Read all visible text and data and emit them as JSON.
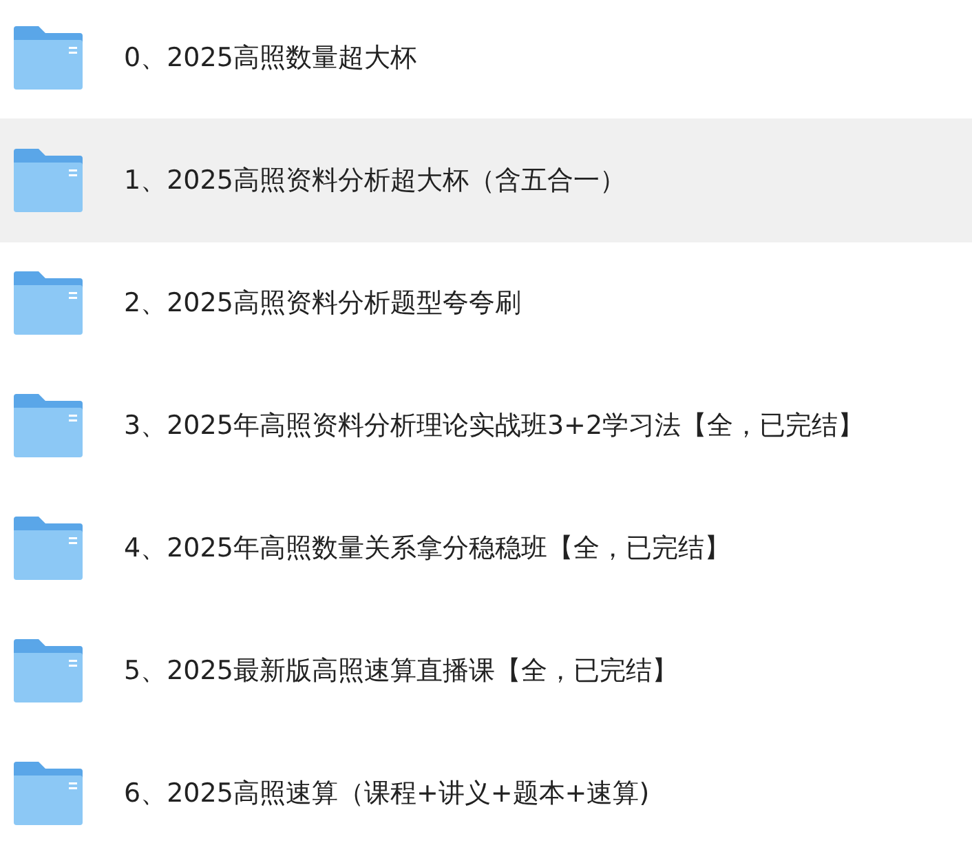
{
  "folders": [
    {
      "name": "0、2025高照数量超大杯",
      "selected": false
    },
    {
      "name": "1、2025高照资料分析超大杯（含五合一）",
      "selected": true
    },
    {
      "name": "2、2025高照资料分析题型夸夸刷",
      "selected": false
    },
    {
      "name": "3、2025年高照资料分析理论实战班3+2学习法【全，已完结】",
      "selected": false
    },
    {
      "name": "4、2025年高照数量关系拿分稳稳班【全，已完结】",
      "selected": false
    },
    {
      "name": "5、2025最新版高照速算直播课【全，已完结】",
      "selected": false
    },
    {
      "name": "6、2025高照速算（课程+讲义+题本+速算)",
      "selected": false
    }
  ]
}
